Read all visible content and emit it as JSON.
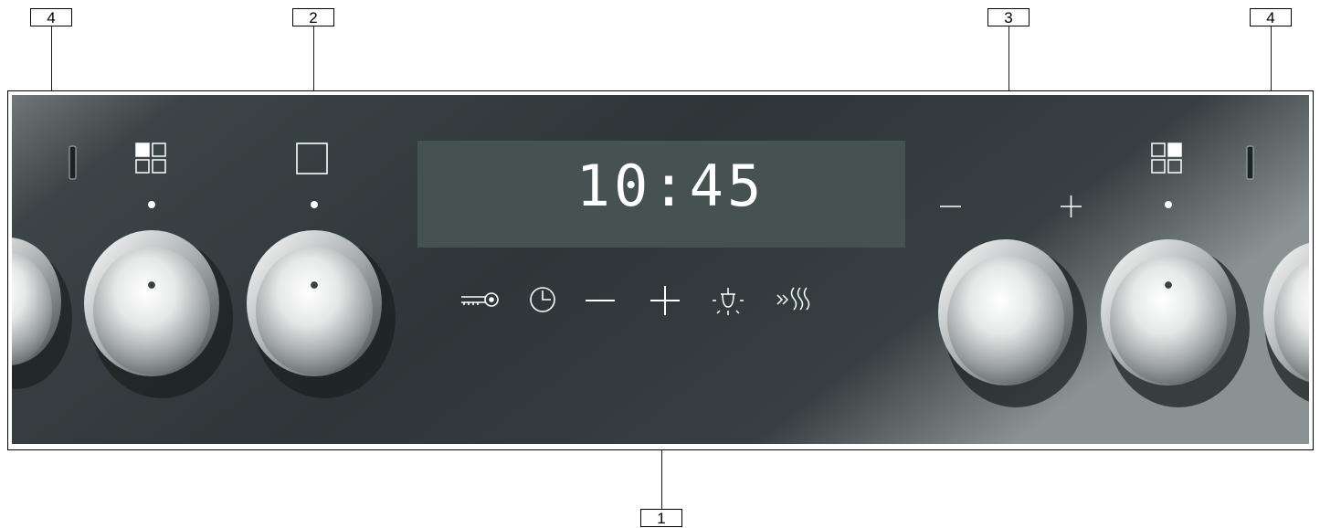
{
  "callouts": {
    "left_indicator": "4",
    "left_function_knob": "2",
    "right_temperature_knob": "3",
    "right_indicator": "4",
    "control_panel": "1"
  },
  "display": {
    "time": "10:45"
  },
  "touch_controls": {
    "icons": [
      "key-icon",
      "clock-icon",
      "minus-icon",
      "plus-icon",
      "lamp-icon",
      "rapid-heat-icon"
    ],
    "minus_symbol": "–",
    "plus_symbol": "+"
  },
  "knob_labels": {
    "left_hob_icon": "hob-zone-front-left-icon",
    "function_icon": "square-icon",
    "right_hob_icon": "hob-zone-front-right-icon",
    "setting_minus": "–",
    "setting_plus": "+"
  },
  "colors": {
    "panel_dark": "#2f3a3c",
    "panel_light": "#7f8989",
    "display_bg": "#465252",
    "symbol_white": "#ffffff"
  }
}
